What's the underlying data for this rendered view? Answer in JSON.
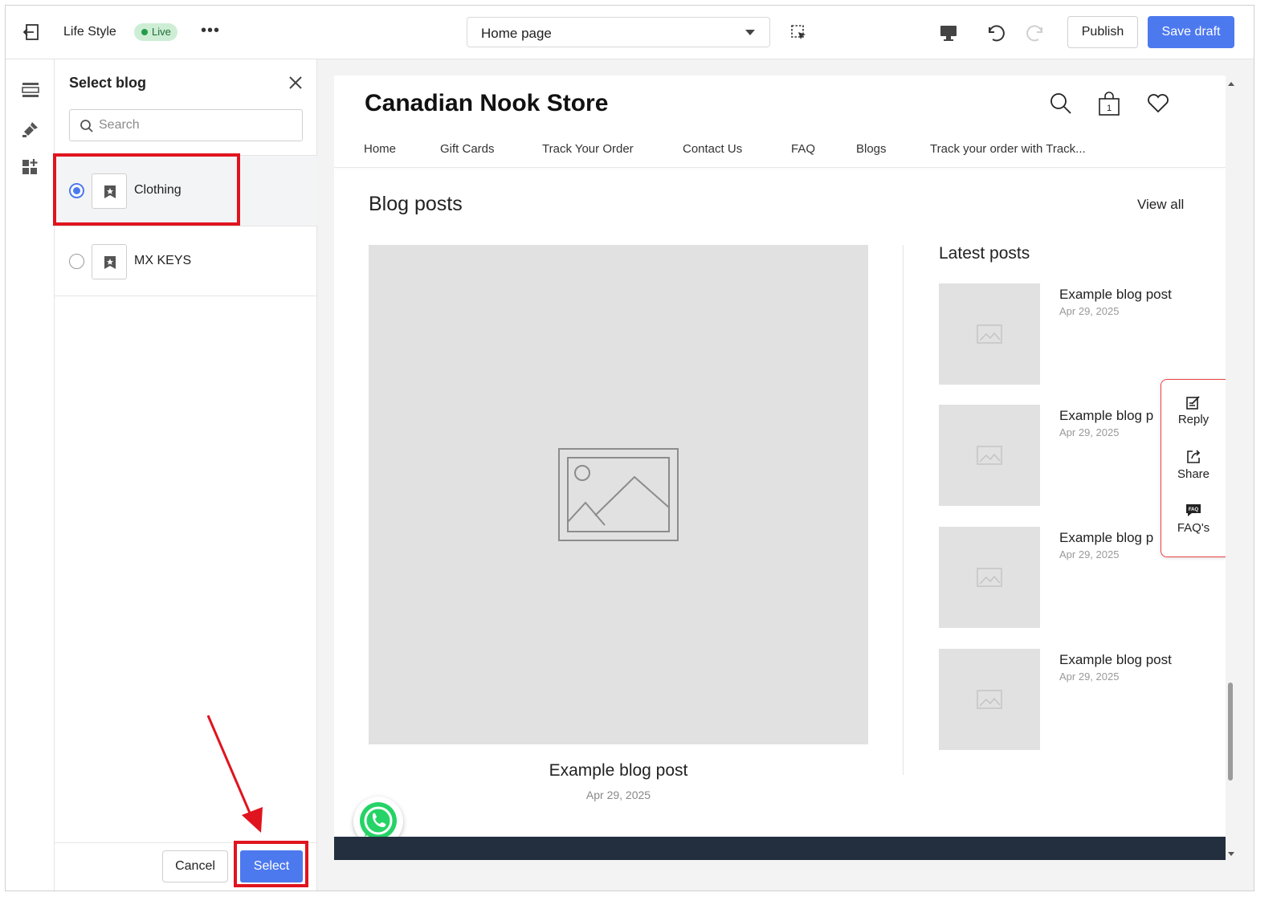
{
  "topbar": {
    "store_name": "Life Style",
    "status_badge": "Live",
    "more_label": "•••",
    "page_selector": "Home page",
    "publish_label": "Publish",
    "save_draft_label": "Save draft"
  },
  "panel": {
    "title": "Select blog",
    "search_placeholder": "Search",
    "blogs": [
      {
        "name": "Clothing",
        "selected": true
      },
      {
        "name": "MX KEYS",
        "selected": false
      }
    ],
    "cancel_label": "Cancel",
    "select_label": "Select"
  },
  "preview": {
    "store_name": "Canadian Nook Store",
    "cart_count": "1",
    "nav": [
      "Home",
      "Gift Cards",
      "Track Your Order",
      "Contact Us",
      "FAQ",
      "Blogs",
      "Track your order with Track..."
    ],
    "section_title": "Blog posts",
    "view_all": "View all",
    "featured": {
      "title": "Example blog post",
      "date": "Apr 29, 2025"
    },
    "latest_title": "Latest posts",
    "latest_posts": [
      {
        "title": "Example blog post",
        "date": "Apr 29, 2025"
      },
      {
        "title": "Example blog p",
        "date": "Apr 29, 2025"
      },
      {
        "title": "Example blog p",
        "date": "Apr 29, 2025"
      },
      {
        "title": "Example blog post",
        "date": "Apr 29, 2025"
      }
    ],
    "widget": {
      "reply": "Reply",
      "share": "Share",
      "faqs": "FAQ's"
    }
  },
  "colors": {
    "accent": "#4d79ef",
    "highlight": "#e0141e",
    "live_badge": "#cdeed4",
    "footer": "#232f3e"
  },
  "icons": [
    "exit-icon",
    "select-element-icon",
    "desktop-icon",
    "undo-icon",
    "redo-icon",
    "sections-icon",
    "theme-icon",
    "apps-icon",
    "close-icon",
    "search-icon",
    "blog-icon",
    "cart-icon",
    "heart-icon",
    "image-placeholder-icon",
    "reply-icon",
    "share-icon",
    "faq-icon",
    "whatsapp-icon"
  ]
}
